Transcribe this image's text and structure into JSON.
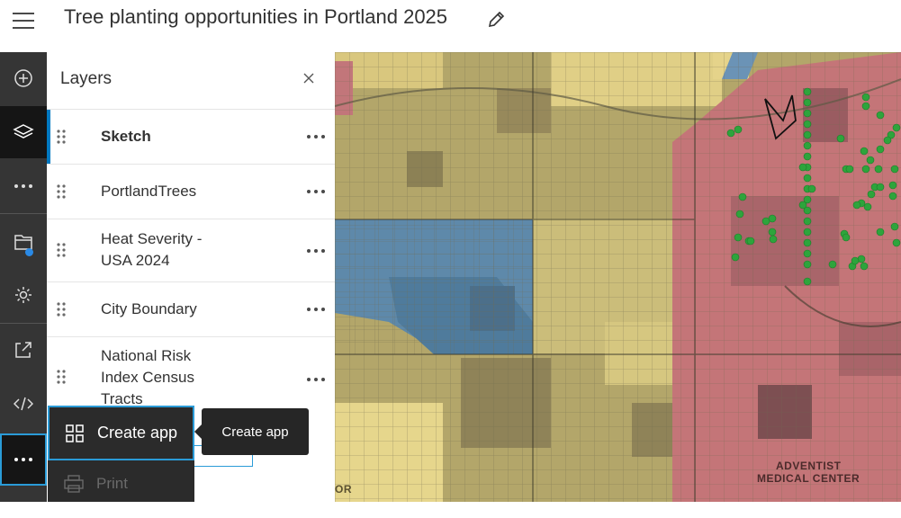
{
  "header": {
    "title": "Tree planting opportunities in Portland 2025",
    "menu_icon": "hamburger-menu-icon",
    "edit_icon": "pencil-icon"
  },
  "toolbar": {
    "items": [
      {
        "icon": "add-icon"
      },
      {
        "icon": "layers-icon"
      },
      {
        "icon": "more-icon"
      },
      {
        "icon": "save-icon"
      },
      {
        "icon": "settings-icon"
      },
      {
        "icon": "share-icon"
      },
      {
        "icon": "embed-icon"
      },
      {
        "icon": "more-icon"
      }
    ]
  },
  "panel": {
    "title": "Layers",
    "layers": [
      {
        "name": "Sketch"
      },
      {
        "name": "PortlandTrees"
      },
      {
        "name": "Heat Severity -",
        "name2": "USA 2024"
      },
      {
        "name": "City Boundary"
      },
      {
        "name": "National Risk",
        "name2": "Index Census",
        "name3": "Tracts"
      }
    ]
  },
  "menu": {
    "create_app": "Create app",
    "print": "Print"
  },
  "tooltip": {
    "text": "Create app"
  },
  "map": {
    "label_line1": "ADVENTIST",
    "label_line2": "MEDICAL CENTER",
    "label_partial": "OR"
  },
  "colors": {
    "accent": "#0079c1",
    "toolbar_bg": "#353535",
    "heat_low": "#e8d58a",
    "heat_mid": "#b1a468",
    "heat_high": "#c26f73",
    "cool": "#5b86a8",
    "tree_dot": "#2ea43c"
  }
}
